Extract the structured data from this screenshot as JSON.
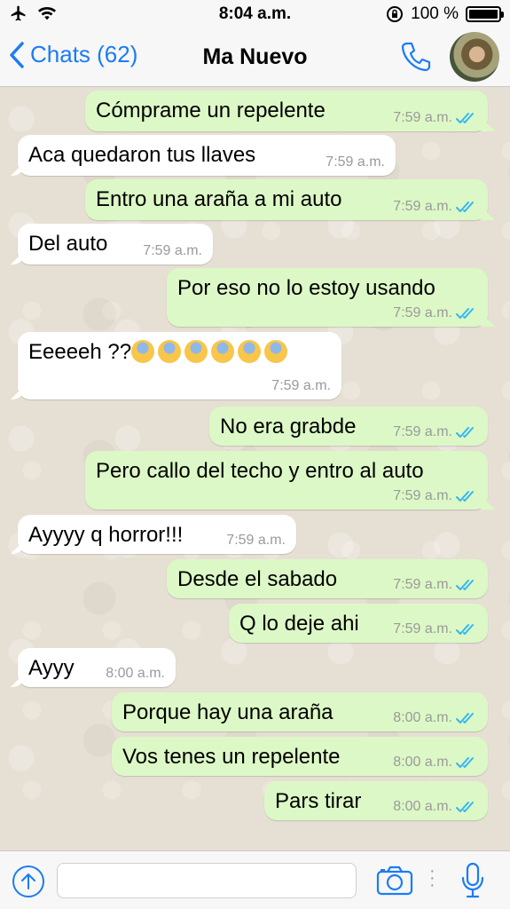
{
  "status_bar": {
    "time": "8:04 a.m.",
    "battery": "100 %"
  },
  "nav": {
    "back_label": "Chats (62)",
    "contact_name": "Ma Nuevo"
  },
  "messages": [
    {
      "dir": "out",
      "text": "Cómprame un repelente",
      "time": "7:59 a.m."
    },
    {
      "dir": "in",
      "text": "Aca quedaron tus llaves",
      "time": "7:59 a.m."
    },
    {
      "dir": "out",
      "text": "Entro una araña a mi auto",
      "time": "7:59 a.m."
    },
    {
      "dir": "in",
      "text": "Del auto",
      "time": "7:59 a.m."
    },
    {
      "dir": "out",
      "text": "Por eso no lo estoy usando",
      "time": "7:59 a.m."
    },
    {
      "dir": "in",
      "text": "Eeeeeh ??",
      "emoji_count": 6,
      "time": "7:59 a.m."
    },
    {
      "dir": "out",
      "text": "No era grabde",
      "time": "7:59 a.m."
    },
    {
      "dir": "out",
      "text": "Pero callo del techo y entro al auto",
      "time": "7:59 a.m."
    },
    {
      "dir": "in",
      "text": "Ayyyy q horror!!!",
      "time": "7:59 a.m."
    },
    {
      "dir": "out",
      "text": "Desde el sabado",
      "time": "7:59 a.m."
    },
    {
      "dir": "out",
      "text": "Q lo deje ahi",
      "time": "7:59 a.m."
    },
    {
      "dir": "in",
      "text": "Ayyy",
      "time": "8:00 a.m."
    },
    {
      "dir": "out",
      "text": "Porque hay una araña",
      "time": "8:00 a.m."
    },
    {
      "dir": "out",
      "text": "Vos tenes un repelente",
      "time": "8:00 a.m."
    },
    {
      "dir": "out",
      "text": "Pars tirar",
      "time": "8:00 a.m."
    }
  ],
  "colors": {
    "accent": "#1b7cf5",
    "outgoing_bubble": "#dcf8c6",
    "incoming_bubble": "#ffffff",
    "read_ticks": "#34b7f1"
  }
}
